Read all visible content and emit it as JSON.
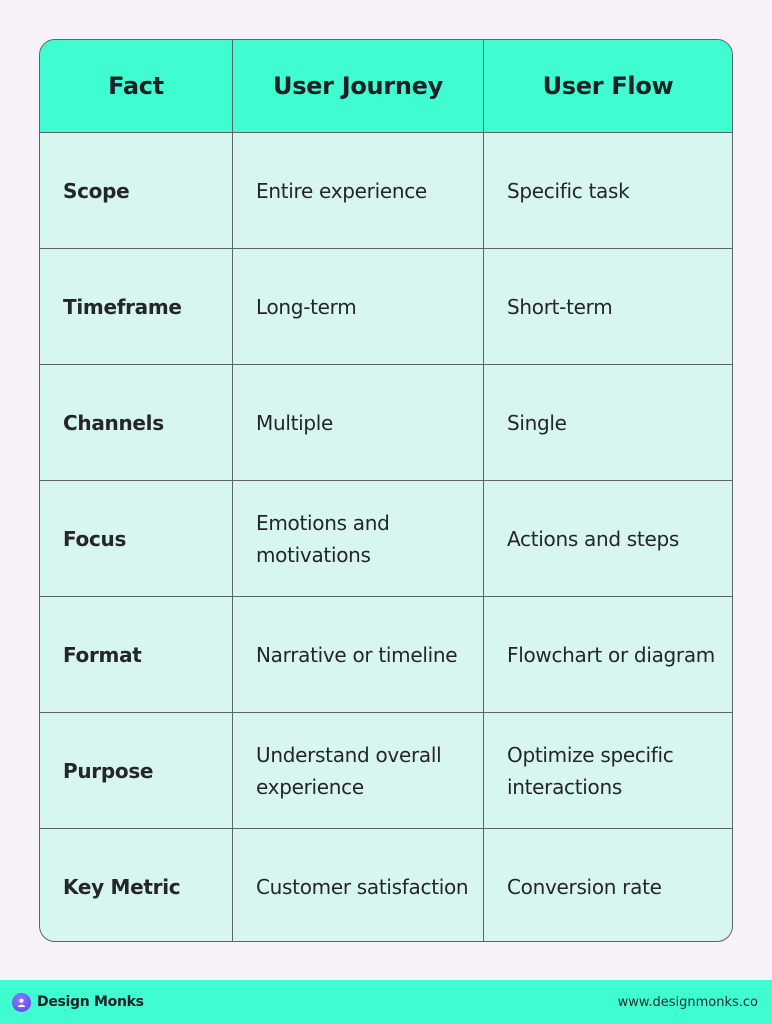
{
  "table": {
    "headers": [
      "Fact",
      "User Journey",
      "User Flow"
    ],
    "rows": [
      {
        "fact": "Scope",
        "journey": "Entire experience",
        "flow": "Specific task"
      },
      {
        "fact": "Timeframe",
        "journey": "Long-term",
        "flow": "Short-term"
      },
      {
        "fact": "Channels",
        "journey": "Multiple",
        "flow": "Single"
      },
      {
        "fact": "Focus",
        "journey": "Emotions and motivations",
        "flow": "Actions and steps"
      },
      {
        "fact": "Format",
        "journey": "Narrative or timeline",
        "flow": "Flowchart or diagram"
      },
      {
        "fact": "Purpose",
        "journey": "Understand overall experience",
        "flow": "Optimize specific interactions"
      },
      {
        "fact": "Key Metric",
        "journey": "Customer satisfaction",
        "flow": "Conversion rate"
      }
    ]
  },
  "footer": {
    "brand_name": "Design Monks",
    "logo_icon": "design-monks-logo",
    "url": "www.designmonks.co"
  },
  "colors": {
    "accent": "#3ffdd1",
    "cell_background": "#d8f6f0",
    "page_background": "#f7f2f9",
    "border": "#5f6266",
    "logo": "#6b4ef5"
  }
}
